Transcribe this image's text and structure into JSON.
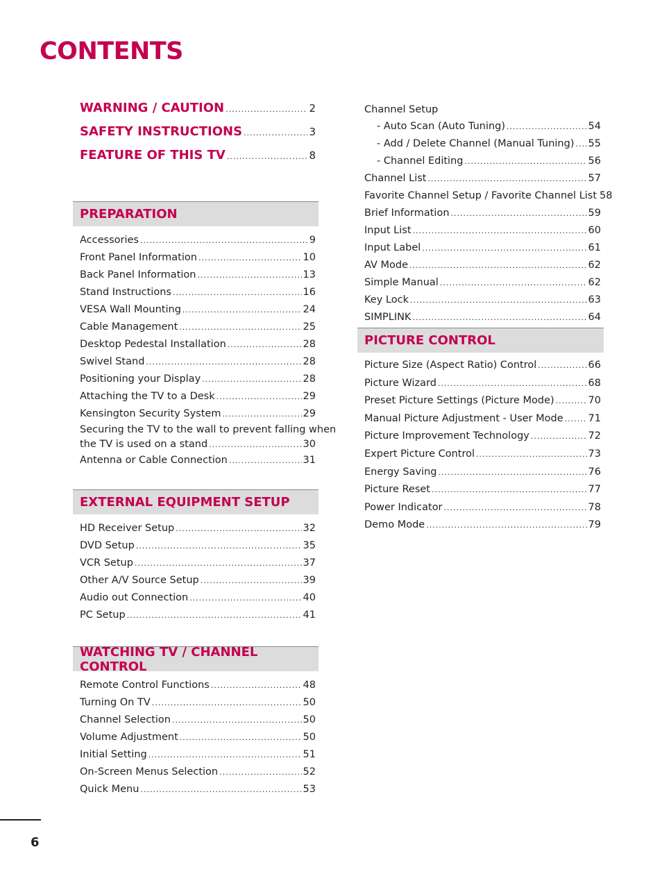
{
  "page": {
    "title": "CONTENTS",
    "page_number": "6"
  },
  "top_links": [
    {
      "label": "WARNING / CAUTION",
      "page": "2"
    },
    {
      "label": "SAFETY INSTRUCTIONS",
      "page": "3"
    },
    {
      "label": "FEATURE OF THIS TV",
      "page": "8"
    }
  ],
  "sections": {
    "preparation": {
      "title": "PREPARATION",
      "entries": [
        {
          "label": "Accessories",
          "page": "9"
        },
        {
          "label": "Front Panel Information",
          "page": "10"
        },
        {
          "label": "Back Panel Information",
          "page": "13"
        },
        {
          "label": "Stand Instructions",
          "page": "16"
        },
        {
          "label": "VESA Wall Mounting",
          "page": "24"
        },
        {
          "label": "Cable Management",
          "page": "25"
        },
        {
          "label": "Desktop Pedestal Installation",
          "page": "28"
        },
        {
          "label": "Swivel Stand",
          "page": "28"
        },
        {
          "label": "Positioning your Display",
          "page": "28"
        },
        {
          "label": "Attaching the TV to a Desk",
          "page": "29"
        },
        {
          "label": "Kensington Security System",
          "page": "29"
        },
        {
          "label_line1": "Securing the TV to the wall to prevent falling when",
          "label_line2": "the TV is used on a stand",
          "page": "30"
        },
        {
          "label": "Antenna or Cable Connection",
          "page": "31"
        }
      ]
    },
    "external": {
      "title": "EXTERNAL EQUIPMENT SETUP",
      "entries": [
        {
          "label": "HD Receiver Setup",
          "page": "32"
        },
        {
          "label": "DVD Setup",
          "page": "35"
        },
        {
          "label": "VCR Setup",
          "page": "37"
        },
        {
          "label": "Other A/V Source Setup",
          "page": "39"
        },
        {
          "label": "Audio out Connection",
          "page": "40"
        },
        {
          "label": "PC Setup",
          "page": "41"
        }
      ]
    },
    "watching": {
      "title": "WATCHING TV / CHANNEL CONTROL",
      "entries": [
        {
          "label": "Remote Control Functions",
          "page": "48"
        },
        {
          "label": "Turning On TV",
          "page": "50"
        },
        {
          "label": "Channel Selection",
          "page": "50"
        },
        {
          "label": "Volume Adjustment",
          "page": "50"
        },
        {
          "label": "Initial Setting",
          "page": "51"
        },
        {
          "label": "On-Screen Menus Selection",
          "page": "52"
        },
        {
          "label": "Quick Menu",
          "page": "53"
        }
      ]
    },
    "channel": {
      "entries": [
        {
          "label": "Channel Setup"
        },
        {
          "label": "- Auto Scan (Auto Tuning)",
          "page": "54"
        },
        {
          "label": "- Add / Delete Channel (Manual Tuning)",
          "page": "55"
        },
        {
          "label": "- Channel Editing",
          "page": "56"
        },
        {
          "label": "Channel List",
          "page": "57"
        },
        {
          "label": "Favorite Channel Setup / Favorite Channel List",
          "page": "58"
        },
        {
          "label": "Brief Information",
          "page": "59"
        },
        {
          "label": "Input List",
          "page": "60"
        },
        {
          "label": "Input Label",
          "page": "61"
        },
        {
          "label": "AV Mode",
          "page": "62"
        },
        {
          "label": "Simple Manual",
          "page": "62"
        },
        {
          "label": "Key Lock",
          "page": "63"
        },
        {
          "label": "SIMPLINK",
          "page": "64"
        }
      ]
    },
    "picture": {
      "title": "PICTURE CONTROL",
      "entries": [
        {
          "label": "Picture Size (Aspect Ratio) Control",
          "page": "66"
        },
        {
          "label": "Picture Wizard",
          "page": "68"
        },
        {
          "label": "Preset Picture Settings (Picture Mode)",
          "page": "70"
        },
        {
          "label": "Manual Picture Adjustment - User Mode",
          "page": "71"
        },
        {
          "label": "Picture Improvement Technology",
          "page": "72"
        },
        {
          "label": "Expert Picture Control",
          "page": "73"
        },
        {
          "label": "Energy Saving",
          "page": "76"
        },
        {
          "label": "Picture Reset",
          "page": "77"
        },
        {
          "label": "Power Indicator",
          "page": "78"
        },
        {
          "label": "Demo Mode",
          "page": "79"
        }
      ]
    }
  },
  "colors": {
    "accent": "#c4004f",
    "header_bg": "#dcdcdc",
    "text": "#231f20"
  }
}
